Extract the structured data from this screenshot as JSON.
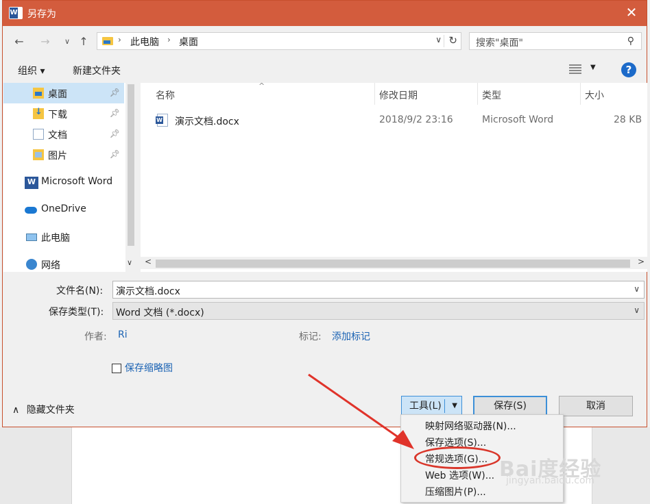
{
  "dialog": {
    "title": "另存为",
    "app_icon_letter": "W"
  },
  "address": {
    "crumbs": [
      "此电脑",
      "桌面"
    ]
  },
  "search": {
    "placeholder": "搜索\"桌面\""
  },
  "toolbar": {
    "organize": "组织 ▾",
    "new_folder": "新建文件夹",
    "help": "?"
  },
  "sidebar": {
    "items": [
      {
        "label": "桌面",
        "pinned": true,
        "selected": true
      },
      {
        "label": "下载",
        "pinned": true
      },
      {
        "label": "文档",
        "pinned": true
      },
      {
        "label": "图片",
        "pinned": true
      },
      {
        "label": "Microsoft Word"
      },
      {
        "label": "OneDrive"
      },
      {
        "label": "此电脑"
      },
      {
        "label": "网络"
      }
    ]
  },
  "filelist": {
    "columns": [
      "名称",
      "修改日期",
      "类型",
      "大小"
    ],
    "rows": [
      {
        "name": "演示文档.docx",
        "modified": "2018/9/2 23:16",
        "type": "Microsoft Word",
        "size": "28 KB"
      }
    ]
  },
  "form": {
    "filename_label": "文件名(N):",
    "filename_value": "演示文档.docx",
    "filetype_label": "保存类型(T):",
    "filetype_value": "Word 文档 (*.docx)",
    "author_label": "作者:",
    "author_value": "Ri",
    "tags_label": "标记:",
    "tags_value": "添加标记",
    "thumbnail_label": "保存缩略图"
  },
  "footer": {
    "hide_folders": "隐藏文件夹",
    "tools": "工具(L)",
    "save": "保存(S)",
    "cancel": "取消"
  },
  "tools_menu": {
    "items": [
      "映射网络驱动器(N)...",
      "保存选项(S)...",
      "常规选项(G)...",
      "Web 选项(W)...",
      "压缩图片(P)..."
    ],
    "highlighted_index": 2
  },
  "watermark": {
    "logo": "Bai度经验",
    "url": "jingyan.baidu.com"
  },
  "colors": {
    "titlebar": "#d35c3d",
    "accent": "#3c8fd8",
    "annotation": "#d9362a"
  }
}
